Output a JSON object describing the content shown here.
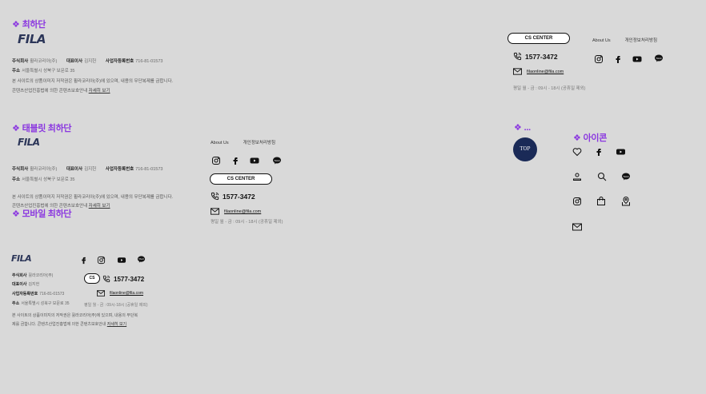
{
  "desktop": {
    "title": "최하단",
    "logo": "FILA",
    "company_label": "주식회사",
    "company": "휠라코리아(주)",
    "ceo_label": "대표이사",
    "ceo": "김지헌",
    "bizno_label": "사업자등록번호",
    "bizno": "716-81-01573",
    "addr_label": "주소",
    "addr": "서울특별시 성북구 보문로 35",
    "copyright": "본 사이트의 상품이미지 저작권은 휠라코리아(주)에 있으며, 내용의 무단복제를 금합니다.",
    "content_law": "콘텐츠산업진흥법에 의한 콘텐츠보호안내",
    "content_law_link": "자세히 보기",
    "cs_center": "CS CENTER",
    "about": "About Us",
    "privacy": "개인정보처리방침",
    "phone": "1577-3472",
    "email": "filaonline@fila.com",
    "hours": "평일 월 - 금 : 09시 - 18시 (공휴일 제외)"
  },
  "tablet": {
    "title": "태블릿 최하단",
    "logo": "FILA",
    "company_label": "주식회사",
    "company": "휠라코리아(주)",
    "ceo_label": "대표이사",
    "ceo": "김지헌",
    "bizno_label": "사업자등록번호",
    "bizno": "716-81-01573",
    "addr_label": "주소",
    "addr": "서울특별시 성북구 보문로 35",
    "copyright": "본 사이트의 상품이미지 저작권은 휠라코리아(주)에 있으며, 내용의 무단복제를 금합니다.",
    "content_law": "콘텐츠산업진흥법에 의한 콘텐츠보호안내",
    "content_law_link": "자세히 보기",
    "about": "About Us",
    "privacy": "개인정보처리방침",
    "cs_center": "CS CENTER",
    "phone": "1577-3472",
    "email": "filaonline@fila.com",
    "hours": "평일 월 - 금 : 09시 - 18시 (공휴일 제외)"
  },
  "mobile": {
    "title": "모바일 최하단",
    "logo": "FILA",
    "company_label": "주식회사",
    "company": "휠라코리아(주)",
    "ceo_label": "대표이사",
    "ceo": "김지헌",
    "bizno_label": "사업자등록번호",
    "bizno": "716-81-01573",
    "addr_label": "주소",
    "addr": "서울특별시 성북구 보문로 35",
    "cs": "CS",
    "phone": "1577-3472",
    "email": "filaonline@fila.com",
    "hours": "평일 월 - 금 : 09시-18시 (공휴일 제외)",
    "copyright1": "본 사이트의 상품이미지의 저작권은 휠라코리아(주)에 있으며, 내용의 무단복",
    "copyright2": "제를 금합니다. 콘텐츠산업진흥법에 의한 콘텐츠보호안내",
    "content_law_link": "자세히 보기"
  },
  "misc": {
    "title": "...",
    "top_button": "TOP"
  },
  "icons_section": {
    "title": "아이콘"
  },
  "diamond": "❖"
}
